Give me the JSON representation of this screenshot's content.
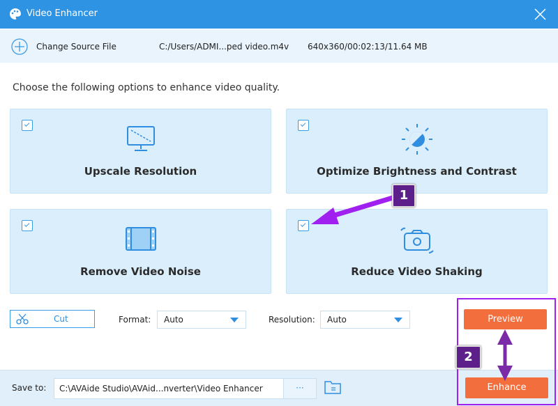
{
  "window": {
    "title": "Video Enhancer"
  },
  "source": {
    "change_label": "Change Source File",
    "path": "C:/Users/ADMI...ped video.m4v",
    "info": "640x360/00:02:13/11.64 MB"
  },
  "instructions": "Choose the following options to enhance video quality.",
  "options": [
    {
      "label": "Upscale Resolution",
      "checked": true,
      "icon": "monitor-icon"
    },
    {
      "label": "Optimize Brightness and Contrast",
      "checked": true,
      "icon": "brightness-icon"
    },
    {
      "label": "Remove Video Noise",
      "checked": true,
      "icon": "film-icon"
    },
    {
      "label": "Reduce Video Shaking",
      "checked": true,
      "icon": "shaking-camera-icon"
    }
  ],
  "controls": {
    "cut_label": "Cut",
    "format_label": "Format:",
    "format_value": "Auto",
    "resolution_label": "Resolution:",
    "resolution_value": "Auto",
    "preview_label": "Preview"
  },
  "footer": {
    "save_to_label": "Save to:",
    "save_path": "C:\\AVAide Studio\\AVAid...nverter\\Video Enhancer",
    "browse_label": "···",
    "enhance_label": "Enhance"
  },
  "annotations": {
    "step1": "1",
    "step2": "2",
    "color": "#a020f0"
  },
  "colors": {
    "accent": "#2f93e3",
    "button": "#f26e3d"
  }
}
